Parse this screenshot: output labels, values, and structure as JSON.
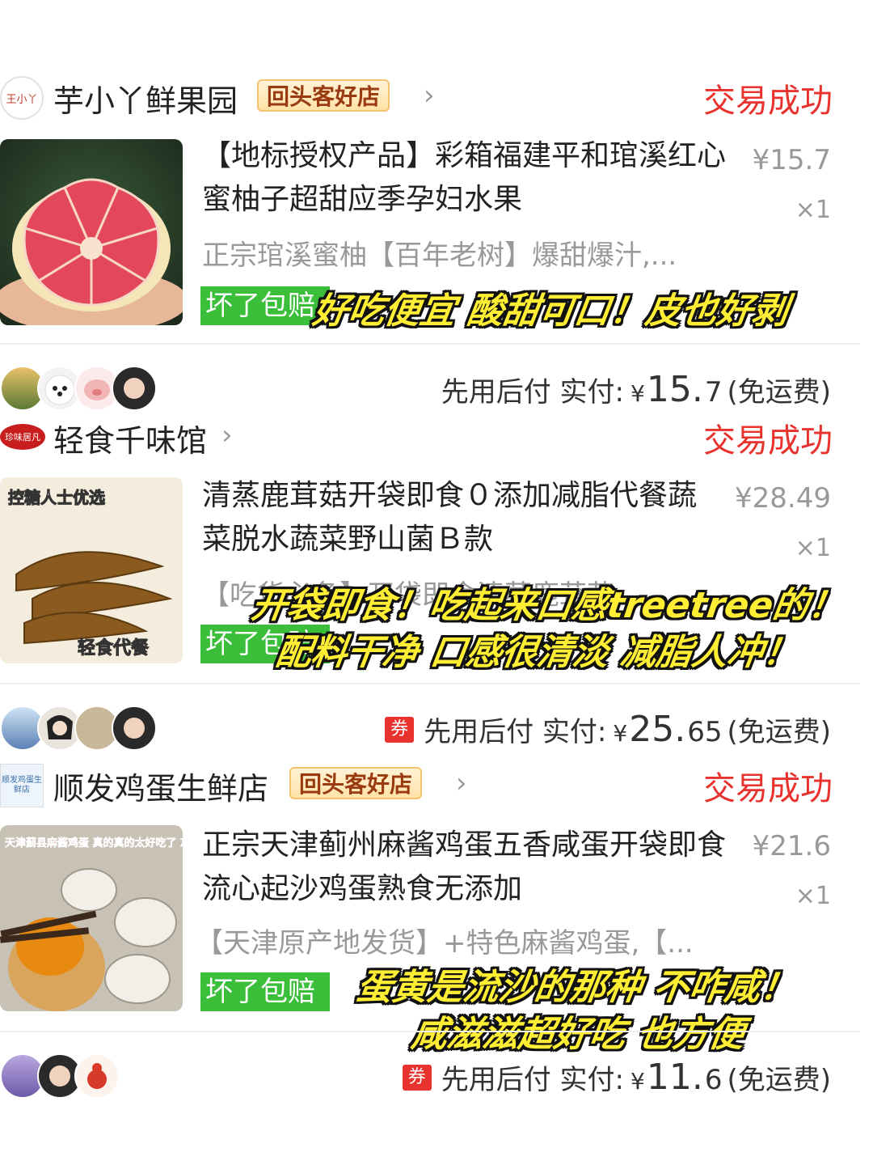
{
  "orders": [
    {
      "shop": {
        "logo_text": "王小丫",
        "name": "芋小丫鲜果园",
        "badge": "回头客好店",
        "chevron": "›",
        "status": "交易成功"
      },
      "item": {
        "title": "【地标授权产品】彩箱福建平和琯溪红心蜜柚子超甜应季孕妇水果",
        "price": "¥15.7",
        "qty": "×1",
        "subtitle": "正宗琯溪蜜柚【百年老树】爆甜爆汁,...",
        "guarantee": "坏了包赔"
      },
      "overlay": [
        "好吃便宜 酸甜可口！皮也好剥"
      ],
      "payment": {
        "prefix": "先用后付 实付:",
        "yen": "¥",
        "amount_big": "15.",
        "amount_small": "7",
        "shipping": "(免运费)"
      }
    },
    {
      "shop": {
        "logo_text": "珍味居凡",
        "name": "轻食千味馆",
        "status": "交易成功",
        "chevron": "›"
      },
      "item": {
        "title": "清蒸鹿茸菇开袋即食０添加减脂代餐蔬菜脱水蔬菜野山菌Ｂ款",
        "price": "¥28.49",
        "qty": "×1",
        "subtitle": "【吃货必备】开袋即食清蒸鹿茸菇",
        "guarantee": "坏了包赔",
        "thumb_text_top": "控糖人士优选",
        "thumb_text_bottom": "轻食代餐"
      },
      "overlay": [
        "开袋即食！吃起来口感treetree的！",
        "配料干净 口感很清淡 减脂人冲！"
      ],
      "payment": {
        "coupon": "券",
        "prefix": "先用后付 实付:",
        "yen": "¥",
        "amount_big": "25.",
        "amount_small": "65",
        "shipping": "(免运费)"
      }
    },
    {
      "shop": {
        "logo_text": "顺发鸡蛋生鲜店",
        "name": "顺发鸡蛋生鲜店",
        "badge": "回头客好店",
        "chevron": "›",
        "status": "交易成功"
      },
      "item": {
        "title": "正宗天津蓟州麻酱鸡蛋五香咸蛋开袋即食流心起沙鸡蛋熟食无添加",
        "price": "¥21.6",
        "qty": "×1",
        "subtitle": "【天津原产地发货】+特色麻酱鸡蛋,【...",
        "guarantee": "坏了包赔",
        "thumb_text": "天津蓟县麻酱鸡蛋 真的真的太好吃了 忘不掉的美味"
      },
      "overlay": [
        "蛋黄是流沙的那种 不咋咸！",
        "咸滋滋超好吃 也方便"
      ],
      "payment": {
        "coupon": "券",
        "prefix": "先用后付 实付:",
        "yen": "¥",
        "amount_big": "11.",
        "amount_small": "6",
        "shipping": "(免运费)"
      }
    }
  ],
  "colors": {
    "status_red": "#e8322d",
    "guarantee_green": "#3bbf3b",
    "overlay_yellow": "#ffee33",
    "badge_brown": "#9a3a10"
  }
}
